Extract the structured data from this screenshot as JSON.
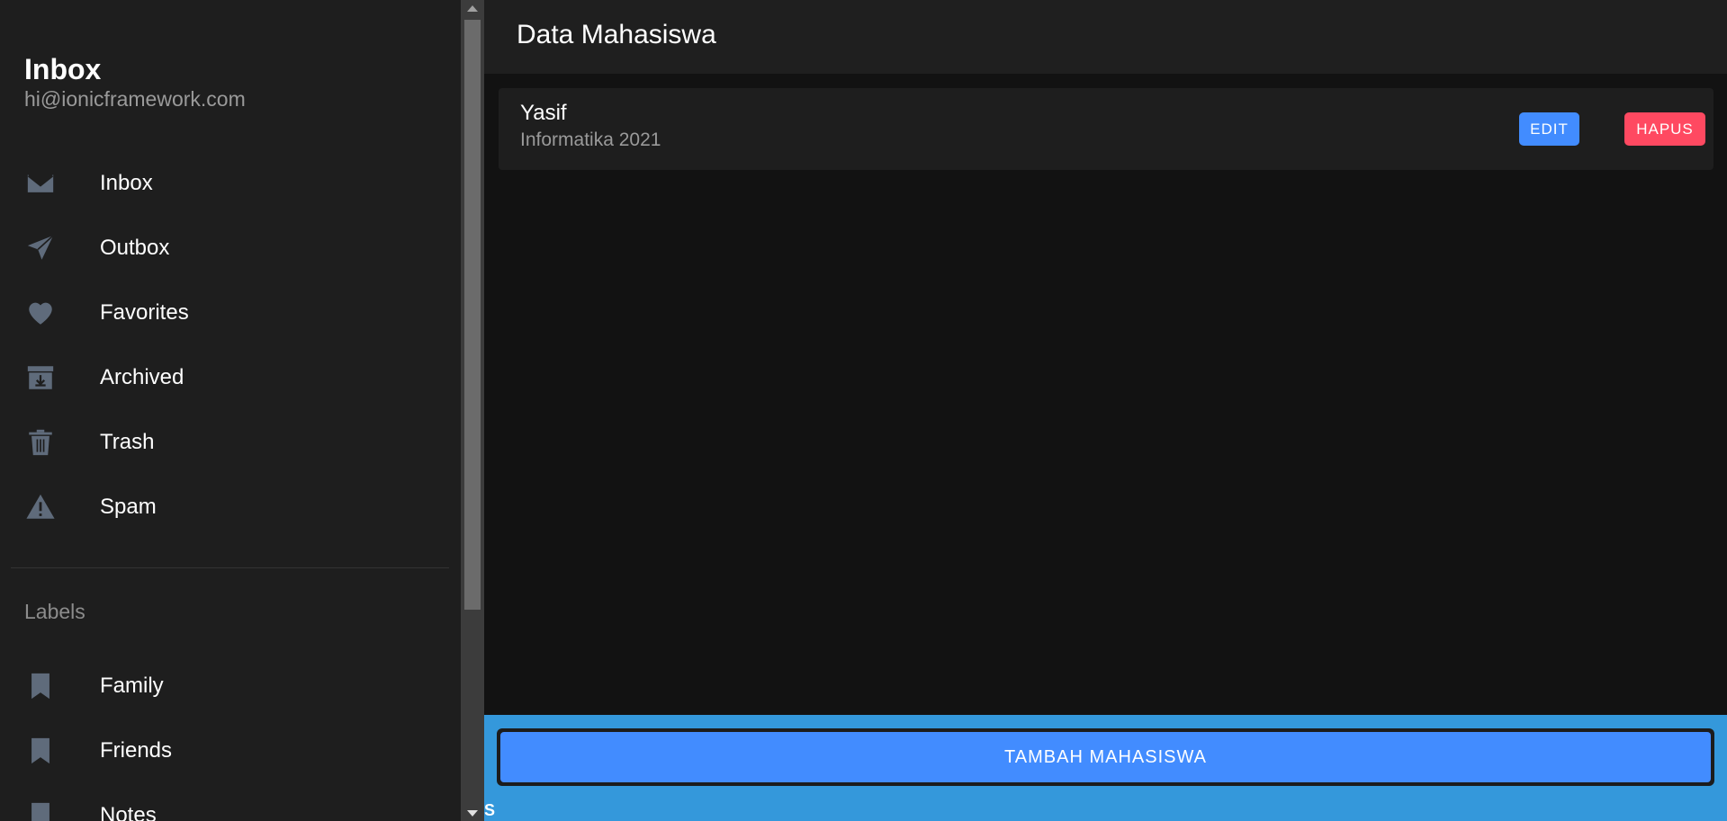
{
  "menu": {
    "title": "Inbox",
    "subtitle": "hi@ionicframework.com",
    "items": [
      {
        "label": "Inbox",
        "icon": "mail-icon"
      },
      {
        "label": "Outbox",
        "icon": "paper-plane-icon"
      },
      {
        "label": "Favorites",
        "icon": "heart-icon"
      },
      {
        "label": "Archived",
        "icon": "archive-icon"
      },
      {
        "label": "Trash",
        "icon": "trash-icon"
      },
      {
        "label": "Spam",
        "icon": "warning-icon"
      }
    ],
    "labels_header": "Labels",
    "labels": [
      {
        "label": "Family",
        "icon": "bookmark-icon"
      },
      {
        "label": "Friends",
        "icon": "bookmark-icon"
      },
      {
        "label": "Notes",
        "icon": "bookmark-icon"
      }
    ]
  },
  "toolbar": {
    "title": "Data Mahasiswa"
  },
  "students": [
    {
      "name": "Yasif",
      "detail": "Informatika 2021",
      "edit_label": "EDIT",
      "delete_label": "HAPUS"
    }
  ],
  "footer": {
    "add_label": "TAMBAH MAHASISWA",
    "partial_text": "S"
  },
  "colors": {
    "primary": "#428cff",
    "danger": "#ff4961",
    "footer_bg": "#3498db",
    "icon": "#5f6b7b",
    "background": "#121212"
  }
}
